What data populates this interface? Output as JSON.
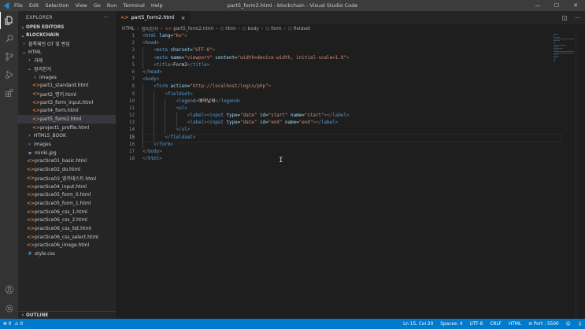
{
  "window": {
    "title": "part5_form2.html - blockchain - Visual Studio Code",
    "menu": [
      "File",
      "Edit",
      "Selection",
      "View",
      "Go",
      "Run",
      "Terminal",
      "Help"
    ],
    "controls": {
      "minimize": "—",
      "maximize": "☐",
      "close": "✕"
    }
  },
  "activitybar": {
    "icons": [
      "explorer-icon",
      "search-icon",
      "source-control-icon",
      "run-debug-icon",
      "extensions-icon",
      "account-icon",
      "settings-icon"
    ]
  },
  "sidebar": {
    "header": "EXPLORER",
    "more": "···",
    "open_editors": "OPEN EDITORS",
    "workspace": "BLOCKCHAIN",
    "outline": "OUTLINE",
    "tree": [
      {
        "label": "블록체인 OT 및 판업",
        "type": "folder",
        "depth": 1,
        "expanded": false
      },
      {
        "label": "HTML",
        "type": "folder",
        "depth": 1,
        "expanded": true
      },
      {
        "label": "과제",
        "type": "folder",
        "depth": 2,
        "expanded": false
      },
      {
        "label": "정리한거",
        "type": "folder",
        "depth": 2,
        "expanded": true
      },
      {
        "label": "images",
        "type": "folder",
        "depth": 3,
        "expanded": false
      },
      {
        "label": "part1_standard.html",
        "type": "html",
        "depth": 3
      },
      {
        "label": "part2_명키.html",
        "type": "html",
        "depth": 3
      },
      {
        "label": "part3_form_input.html",
        "type": "html",
        "depth": 3
      },
      {
        "label": "part4_form.html",
        "type": "html",
        "depth": 3
      },
      {
        "label": "part5_form2.html",
        "type": "html",
        "depth": 3,
        "selected": true
      },
      {
        "label": "project1_profile.html",
        "type": "html",
        "depth": 3
      },
      {
        "label": "HTML5_BOOK",
        "type": "folder",
        "depth": 2,
        "expanded": false
      },
      {
        "label": "images",
        "type": "folder",
        "depth": 2,
        "expanded": false
      },
      {
        "label": "minki.jpg",
        "type": "img",
        "depth": 2
      },
      {
        "label": "practice01_basic.html",
        "type": "html",
        "depth": 2
      },
      {
        "label": "practice02_do.html",
        "type": "html",
        "depth": 2
      },
      {
        "label": "practice03_영키테스트.html",
        "type": "html",
        "depth": 2
      },
      {
        "label": "practice04_input.html",
        "type": "html",
        "depth": 2
      },
      {
        "label": "practice05_form_0.html",
        "type": "html",
        "depth": 2
      },
      {
        "label": "practice05_form_1.html",
        "type": "html",
        "depth": 2
      },
      {
        "label": "practice06_css_1.html",
        "type": "html",
        "depth": 2
      },
      {
        "label": "practice06_css_2.html",
        "type": "html",
        "depth": 2
      },
      {
        "label": "practice06_css_list.html",
        "type": "html",
        "depth": 2
      },
      {
        "label": "practice06_css_select.html",
        "type": "html",
        "depth": 2
      },
      {
        "label": "practice06_image.html",
        "type": "html",
        "depth": 2
      },
      {
        "label": "style.css",
        "type": "css",
        "depth": 2
      }
    ]
  },
  "editor": {
    "tab": {
      "label": "part5_form2.html",
      "close": "×"
    },
    "tab_actions": {
      "split": "◫",
      "more": "···"
    },
    "breadcrumb": [
      "HTML",
      "정리한거",
      "part5_form2.html",
      "html",
      "body",
      "form",
      "fieldset"
    ],
    "current_line": 15,
    "lines": [
      {
        "n": "1",
        "indent": 0,
        "tokens": [
          [
            "br",
            "<"
          ],
          [
            "tag",
            "html"
          ],
          [
            "txt",
            " "
          ],
          [
            "attr",
            "lang"
          ],
          [
            "txt",
            "="
          ],
          [
            "str",
            "\"ko\""
          ],
          [
            "br",
            ">"
          ]
        ]
      },
      {
        "n": "2",
        "indent": 0,
        "tokens": [
          [
            "br",
            "<"
          ],
          [
            "tag",
            "head"
          ],
          [
            "br",
            ">"
          ]
        ]
      },
      {
        "n": "3",
        "indent": 1,
        "tokens": [
          [
            "br",
            "<"
          ],
          [
            "tag",
            "meta"
          ],
          [
            "txt",
            " "
          ],
          [
            "attr",
            "charset"
          ],
          [
            "txt",
            "="
          ],
          [
            "str",
            "\"UTF-8\""
          ],
          [
            "br",
            ">"
          ]
        ]
      },
      {
        "n": "4",
        "indent": 1,
        "tokens": [
          [
            "br",
            "<"
          ],
          [
            "tag",
            "meta"
          ],
          [
            "txt",
            " "
          ],
          [
            "attr",
            "name"
          ],
          [
            "txt",
            "="
          ],
          [
            "str",
            "\"viewport\""
          ],
          [
            "txt",
            " "
          ],
          [
            "attr",
            "content"
          ],
          [
            "txt",
            "="
          ],
          [
            "str",
            "\"width=device-width, initial-scale=1.0\""
          ],
          [
            "br",
            ">"
          ]
        ]
      },
      {
        "n": "5",
        "indent": 1,
        "tokens": [
          [
            "br",
            "<"
          ],
          [
            "tag",
            "title"
          ],
          [
            "br",
            ">"
          ],
          [
            "txt",
            "Form2"
          ],
          [
            "br",
            "</"
          ],
          [
            "tag",
            "title"
          ],
          [
            "br",
            ">"
          ]
        ]
      },
      {
        "n": "6",
        "indent": 0,
        "tokens": [
          [
            "br",
            "</"
          ],
          [
            "tag",
            "head"
          ],
          [
            "br",
            ">"
          ]
        ]
      },
      {
        "n": "7",
        "indent": 0,
        "tokens": [
          [
            "br",
            "<"
          ],
          [
            "tag",
            "body"
          ],
          [
            "br",
            ">"
          ]
        ]
      },
      {
        "n": "8",
        "indent": 1,
        "tokens": [
          [
            "br",
            "<"
          ],
          [
            "tag",
            "form"
          ],
          [
            "txt",
            " "
          ],
          [
            "attr",
            "action"
          ],
          [
            "txt",
            "="
          ],
          [
            "str",
            "\"http://localhost/login/php\""
          ],
          [
            "br",
            ">"
          ]
        ]
      },
      {
        "n": "9",
        "indent": 2,
        "tokens": [
          [
            "br",
            "<"
          ],
          [
            "tag",
            "fieldset"
          ],
          [
            "br",
            ">"
          ]
        ]
      },
      {
        "n": "10",
        "indent": 3,
        "tokens": [
          [
            "br",
            "<"
          ],
          [
            "tag",
            "legend"
          ],
          [
            "br",
            ">"
          ],
          [
            "txt",
            "예약날짜"
          ],
          [
            "br",
            "</"
          ],
          [
            "tag",
            "legend"
          ],
          [
            "br",
            ">"
          ]
        ]
      },
      {
        "n": "11",
        "indent": 3,
        "tokens": [
          [
            "br",
            "<"
          ],
          [
            "tag",
            "ul"
          ],
          [
            "br",
            ">"
          ]
        ]
      },
      {
        "n": "12",
        "indent": 4,
        "tokens": [
          [
            "br",
            "<"
          ],
          [
            "tag",
            "label"
          ],
          [
            "br",
            ">"
          ],
          [
            "br",
            "<"
          ],
          [
            "tag",
            "input"
          ],
          [
            "txt",
            " "
          ],
          [
            "attr",
            "type"
          ],
          [
            "txt",
            "="
          ],
          [
            "str",
            "\"date\""
          ],
          [
            "txt",
            " "
          ],
          [
            "attr",
            "id"
          ],
          [
            "txt",
            "="
          ],
          [
            "str",
            "\"start\""
          ],
          [
            "txt",
            " "
          ],
          [
            "attr",
            "name"
          ],
          [
            "txt",
            "="
          ],
          [
            "str",
            "\"start\""
          ],
          [
            "br",
            ">"
          ],
          [
            "br",
            "</"
          ],
          [
            "tag",
            "label"
          ],
          [
            "br",
            ">"
          ]
        ]
      },
      {
        "n": "13",
        "indent": 4,
        "tokens": [
          [
            "br",
            "<"
          ],
          [
            "tag",
            "label"
          ],
          [
            "br",
            ">"
          ],
          [
            "br",
            "<"
          ],
          [
            "tag",
            "input"
          ],
          [
            "txt",
            " "
          ],
          [
            "attr",
            "type"
          ],
          [
            "txt",
            "="
          ],
          [
            "str",
            "\"date\""
          ],
          [
            "txt",
            " "
          ],
          [
            "attr",
            "id"
          ],
          [
            "txt",
            "="
          ],
          [
            "str",
            "\"end\""
          ],
          [
            "txt",
            " "
          ],
          [
            "attr",
            "name"
          ],
          [
            "txt",
            "="
          ],
          [
            "str",
            "\"end\""
          ],
          [
            "br",
            ">"
          ],
          [
            "br",
            "</"
          ],
          [
            "tag",
            "label"
          ],
          [
            "br",
            ">"
          ]
        ]
      },
      {
        "n": "14",
        "indent": 3,
        "tokens": [
          [
            "br",
            "</"
          ],
          [
            "tag",
            "ul"
          ],
          [
            "br",
            ">"
          ]
        ]
      },
      {
        "n": "15",
        "indent": 2,
        "tokens": [
          [
            "br",
            "</"
          ],
          [
            "tag",
            "fieldset"
          ],
          [
            "br",
            ">"
          ]
        ]
      },
      {
        "n": "16",
        "indent": 1,
        "tokens": [
          [
            "br",
            "</"
          ],
          [
            "tag",
            "form"
          ],
          [
            "br",
            ">"
          ]
        ]
      },
      {
        "n": "17",
        "indent": 0,
        "tokens": [
          [
            "br",
            "</"
          ],
          [
            "tag",
            "body"
          ],
          [
            "br",
            ">"
          ]
        ]
      },
      {
        "n": "18",
        "indent": 0,
        "tokens": [
          [
            "br",
            "</"
          ],
          [
            "tag",
            "html"
          ],
          [
            "br",
            ">"
          ]
        ]
      }
    ]
  },
  "statusbar": {
    "errors": "⊗ 0",
    "warnings": "⚠ 0",
    "position": "Ln 15, Col 20",
    "spaces": "Spaces: 4",
    "encoding": "UTF-8",
    "eol": "CRLF",
    "language": "HTML",
    "port": "⊘ Port : 5500",
    "feedback": "☺",
    "bell": "♫"
  },
  "colors": {
    "accent": "#007acc",
    "titlebar": "#3c3c3c",
    "activitybar": "#333333",
    "sidebar": "#252526",
    "editor": "#1e1e1e",
    "tag": "#569cd6",
    "attr": "#9cdcfe",
    "string": "#ce9178"
  }
}
